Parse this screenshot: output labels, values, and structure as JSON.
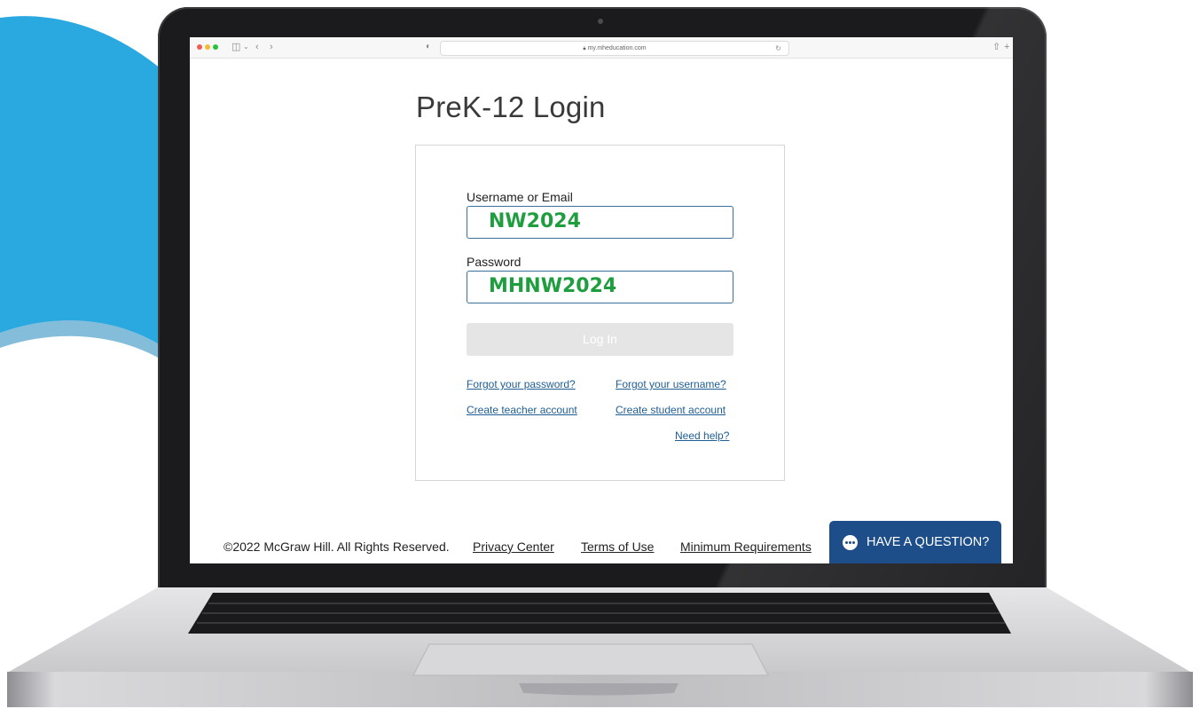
{
  "browser": {
    "url": "my.mheducation.com",
    "icons": [
      "sidebar-icon",
      "back-icon",
      "forward-icon",
      "shield-icon",
      "lock-icon",
      "reload-icon",
      "share-icon",
      "new-tab-icon"
    ]
  },
  "page": {
    "title": "PreK-12 Login"
  },
  "form": {
    "username_label": "Username or Email",
    "username_value": "NW2024",
    "password_label": "Password",
    "password_value": "MHNW2024",
    "login_label": "Log In",
    "value_color": "#1f9e3f"
  },
  "links": {
    "forgot_password": "Forgot your password?",
    "forgot_username": "Forgot your username?",
    "create_teacher": "Create teacher account",
    "create_student": "Create student account",
    "need_help": "Need help?"
  },
  "footer": {
    "copyright": "©2022 McGraw Hill. All Rights Reserved.",
    "privacy": "Privacy Center",
    "terms": "Terms of Use",
    "requirements": "Minimum Requirements"
  },
  "chat": {
    "label": "HAVE A QUESTION?",
    "color": "#1d4e89"
  },
  "colors": {
    "accent_blue": "#2aa8e0",
    "link": "#1f5e94"
  }
}
